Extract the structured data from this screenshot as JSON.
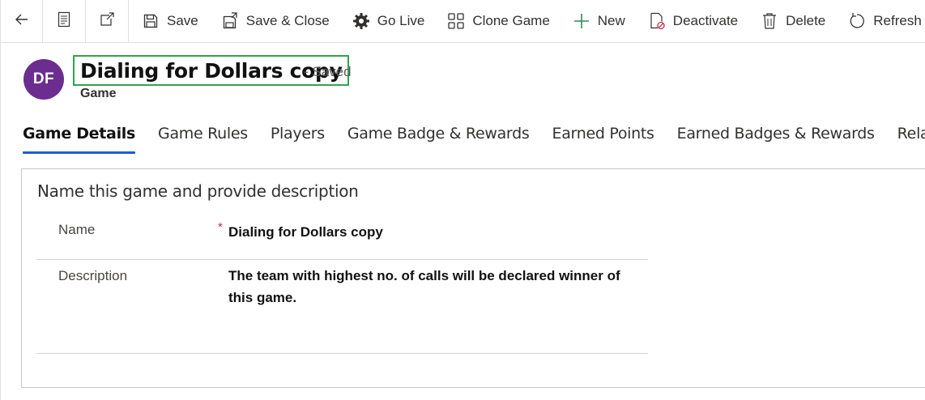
{
  "commandbar": {
    "nav": [
      {
        "name": "back-arrow-icon"
      },
      {
        "name": "form-icon"
      },
      {
        "name": "popout-icon"
      }
    ],
    "commands": [
      {
        "name": "save-button",
        "icon": "save-icon",
        "label": "Save"
      },
      {
        "name": "save-close-button",
        "icon": "save-close-icon",
        "label": "Save & Close"
      },
      {
        "name": "go-live-button",
        "icon": "gear-icon",
        "label": "Go Live"
      },
      {
        "name": "clone-game-button",
        "icon": "grid-icon",
        "label": "Clone Game"
      },
      {
        "name": "new-button",
        "icon": "plus-icon",
        "label": "New"
      },
      {
        "name": "deactivate-button",
        "icon": "deactivate-icon",
        "label": "Deactivate"
      },
      {
        "name": "delete-button",
        "icon": "trash-icon",
        "label": "Delete"
      },
      {
        "name": "refresh-button",
        "icon": "refresh-icon",
        "label": "Refresh"
      }
    ]
  },
  "header": {
    "avatar_initials": "DF",
    "avatar_color": "#6b2d8f",
    "title": "Dialing for Dollars copy",
    "save_status": "- Saved",
    "entity_type": "Game",
    "highlight_color": "#2ea44f"
  },
  "tabs": [
    {
      "label": "Game Details",
      "active": true
    },
    {
      "label": "Game Rules",
      "active": false
    },
    {
      "label": "Players",
      "active": false
    },
    {
      "label": "Game Badge & Rewards",
      "active": false
    },
    {
      "label": "Earned Points",
      "active": false
    },
    {
      "label": "Earned Badges & Rewards",
      "active": false
    },
    {
      "label": "Related",
      "active": false
    }
  ],
  "form": {
    "section_title": "Name this game and provide description",
    "fields": {
      "name": {
        "label": "Name",
        "required_marker": "*",
        "value": "Dialing for Dollars copy"
      },
      "description": {
        "label": "Description",
        "value": "The team with highest no. of calls will be declared winner of this game."
      }
    }
  },
  "colors": {
    "accent": "#1860c7",
    "required": "#c4314b"
  }
}
